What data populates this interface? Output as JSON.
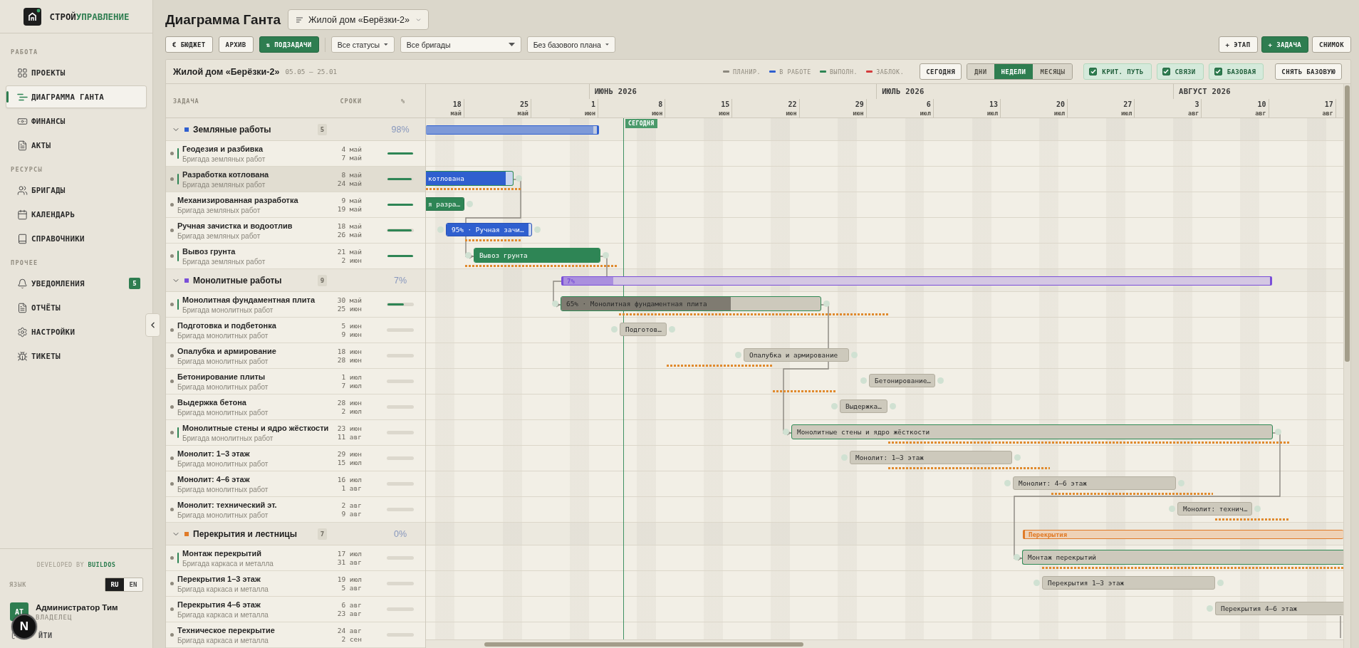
{
  "sidebar": {
    "brand": {
      "prefix": "СТРОЙ",
      "suffix": "УПРАВЛЕНИЕ"
    },
    "sections": [
      {
        "title": "РАБОТА",
        "items": [
          {
            "label": "ПРОЕКТЫ",
            "selected": false
          },
          {
            "label": "ДИАГРАММА ГАНТА",
            "selected": true
          },
          {
            "label": "ФИНАНСЫ",
            "selected": false
          },
          {
            "label": "АКТЫ",
            "selected": false
          }
        ]
      },
      {
        "title": "РЕСУРСЫ",
        "items": [
          {
            "label": "БРИГАДЫ",
            "selected": false
          },
          {
            "label": "КАЛЕНДАРЬ",
            "selected": false
          },
          {
            "label": "СПРАВОЧНИКИ",
            "selected": false
          }
        ]
      },
      {
        "title": "ПРОЧЕЕ",
        "items": [
          {
            "label": "УВЕДОМЛЕНИЯ",
            "selected": false,
            "badge": "5"
          },
          {
            "label": "ОТЧЁТЫ",
            "selected": false
          },
          {
            "label": "НАСТРОЙКИ",
            "selected": false
          },
          {
            "label": "ТИКЕТЫ",
            "selected": false
          }
        ]
      }
    ],
    "credit": "DEVELOPED BY **BUILDOS**",
    "language_label": "ЯЗЫК",
    "languages": [
      {
        "label": "RU",
        "selected": true
      },
      {
        "label": "EN",
        "selected": false
      }
    ],
    "user": {
      "initials": "АТ",
      "name": "Администратор Тим",
      "role": "ВЛАДЕЛЕЦ"
    },
    "logout": "ЙТИ"
  },
  "dev_badge": "N",
  "header": {
    "title": "Диаграмма Ганта",
    "project": "Жилой дом «Берёзки-2»"
  },
  "toolbar": {
    "toggles": [
      {
        "label": "€ БЮДЖЕТ",
        "on": false
      },
      {
        "label": "АРХИВ",
        "on": false
      },
      {
        "label": "⇅ ПОДЗАДАЧИ",
        "on": true
      }
    ],
    "filters": [
      "Все статусы",
      "Все бригады",
      "Без базового плана"
    ],
    "actions": [
      {
        "label": "+ ЭТАП",
        "primary": false
      },
      {
        "label": "+ ЗАДАЧА",
        "primary": true
      },
      {
        "label": "СНИМОК",
        "primary": false
      }
    ]
  },
  "gantt": {
    "title": "Жилой дом «Берёзки-2»",
    "range": "05.05 — 25.01",
    "legend": [
      {
        "label": "ПЛАНИР.",
        "color": "#8c887e"
      },
      {
        "label": "В РАБОТЕ",
        "color": "#2f5fcf"
      },
      {
        "label": "ВЫПОЛН.",
        "color": "#2e8555"
      },
      {
        "label": "ЗАБЛОК.",
        "color": "#d43c3c"
      }
    ],
    "today_button": "СЕГОДНЯ",
    "scales": [
      {
        "label": "ДНИ",
        "selected": false
      },
      {
        "label": "НЕДЕЛИ",
        "selected": true
      },
      {
        "label": "МЕСЯЦЫ",
        "selected": false
      }
    ],
    "toggles": [
      {
        "kind": "critical",
        "label": "КРИТ. ПУТЬ",
        "checked": true
      },
      {
        "kind": "links",
        "label": "СВЯЗИ",
        "checked": true
      },
      {
        "kind": "baseline",
        "label": "БАЗОВАЯ",
        "checked": true
      }
    ],
    "clear_baseline": "СНЯТЬ БАЗОВУЮ",
    "columns": {
      "task": "ЗАДАЧА",
      "dates": "СРОКИ",
      "percent": "%"
    },
    "months": [
      "ИЮНЬ 2026",
      "ИЮЛЬ 2026",
      "АВГУСТ 2026"
    ],
    "weeks": [
      {
        "day": "18",
        "month": "май"
      },
      {
        "day": "25",
        "month": "май"
      },
      {
        "day": "1",
        "month": "июн"
      },
      {
        "day": "8",
        "month": "июн"
      },
      {
        "day": "15",
        "month": "июн"
      },
      {
        "day": "22",
        "month": "июн"
      },
      {
        "day": "29",
        "month": "июн"
      },
      {
        "day": "6",
        "month": "июл"
      },
      {
        "day": "13",
        "month": "июл"
      },
      {
        "day": "20",
        "month": "июл"
      },
      {
        "day": "27",
        "month": "июл"
      },
      {
        "day": "3",
        "month": "авг"
      },
      {
        "day": "10",
        "month": "авг"
      },
      {
        "day": "17",
        "month": "авг"
      }
    ],
    "today_label": "СЕГОДНЯ",
    "groups": [
      {
        "name": "Земляные работы",
        "color": "#2f5fcf",
        "count": "5",
        "percent": "98%",
        "level": 0.98,
        "expanded": true,
        "tasks": [
          {
            "name": "Геодезия и разбивка",
            "crew": "Бригада земляных работ",
            "start": "4 май",
            "end": "7 май",
            "level": 1,
            "critical": true,
            "selected": false
          },
          {
            "name": "Разработка котлована",
            "crew": "Бригада земляных работ",
            "start": "8 май",
            "end": "24 май",
            "level": 0.95,
            "kind": "active",
            "critical": true,
            "selected": true,
            "bar_label": "котлована"
          },
          {
            "name": "Механизированная разработка",
            "crew": "Бригада земляных работ",
            "start": "9 май",
            "end": "19 май",
            "level": 1,
            "kind": "done",
            "critical": false,
            "selected": false,
            "bar_label": "я разра…"
          },
          {
            "name": "Ручная зачистка и водоотлив",
            "crew": "Бригада земляных работ",
            "start": "18 май",
            "end": "26 май",
            "level": 0.95,
            "kind": "active",
            "critical": false,
            "selected": false,
            "bar_label": "95% · Ручная зачи…"
          },
          {
            "name": "Вывоз грунта",
            "crew": "Бригада земляных работ",
            "start": "21 май",
            "end": "2 июн",
            "level": 1,
            "kind": "done",
            "critical": true,
            "selected": false,
            "bar_label": "Вывоз грунта"
          }
        ]
      },
      {
        "name": "Монолитные работы",
        "color": "#7a4fd8",
        "count": "9",
        "percent": "7%",
        "level": 0.07,
        "expanded": true,
        "bar_label": "7%",
        "tasks": [
          {
            "name": "Монолитная фундаментная плита",
            "crew": "Бригада монолитных работ",
            "start": "30 май",
            "end": "25 июн",
            "level": 0.65,
            "kind": "planned",
            "critical": true,
            "selected": false,
            "bar_label": "65% · Монолитная фундаментная плита"
          },
          {
            "name": "Подготовка и подбетонка",
            "crew": "Бригада монолитных работ",
            "start": "5 июн",
            "end": "9 июн",
            "level": 0,
            "kind": "planned",
            "critical": false,
            "selected": false,
            "bar_label": "Подготов…"
          },
          {
            "name": "Опалубка и армирование",
            "crew": "Бригада монолитных работ",
            "start": "18 июн",
            "end": "28 июн",
            "level": 0,
            "kind": "planned",
            "critical": false,
            "selected": false,
            "bar_label": "Опалубка и армирование"
          },
          {
            "name": "Бетонирование плиты",
            "crew": "Бригада монолитных работ",
            "start": "1 июл",
            "end": "7 июл",
            "level": 0,
            "kind": "planned",
            "critical": false,
            "selected": false,
            "bar_label": "Бетонирование…"
          },
          {
            "name": "Выдержка бетона",
            "crew": "Бригада монолитных работ",
            "start": "28 июн",
            "end": "2 июл",
            "level": 0,
            "kind": "planned",
            "critical": false,
            "selected": false,
            "bar_label": "Выдержка…"
          },
          {
            "name": "Монолитные стены и ядро жёсткости",
            "crew": "Бригада монолитных работ",
            "start": "23 июн",
            "end": "11 авг",
            "level": 0,
            "kind": "planned",
            "critical": true,
            "selected": false,
            "bar_label": "Монолитные стены и ядро жёсткости"
          },
          {
            "name": "Монолит: 1–3 этаж",
            "crew": "Бригада монолитных работ",
            "start": "29 июн",
            "end": "15 июл",
            "level": 0,
            "kind": "planned",
            "critical": false,
            "selected": false,
            "bar_label": "Монолит: 1–3 этаж"
          },
          {
            "name": "Монолит: 4–6 этаж",
            "crew": "Бригада монолитных работ",
            "start": "16 июл",
            "end": "1 авг",
            "level": 0,
            "kind": "planned",
            "critical": false,
            "selected": false,
            "bar_label": "Монолит: 4–6 этаж"
          },
          {
            "name": "Монолит: технический эт.",
            "crew": "Бригада монолитных работ",
            "start": "2 авг",
            "end": "9 авг",
            "level": 0,
            "kind": "planned",
            "critical": false,
            "selected": false,
            "bar_label": "Монолит: технич…"
          }
        ]
      },
      {
        "name": "Перекрытия и лестницы",
        "color": "#e07b28",
        "count": "7",
        "percent": "0%",
        "expanded": true,
        "bar_label": "Перекрытия",
        "tasks": [
          {
            "name": "Монтаж перекрытий",
            "crew": "Бригада каркаса и металла",
            "start": "17 июл",
            "end": "31 авг",
            "level": 0,
            "kind": "planned",
            "critical": true,
            "selected": false,
            "bar_label": "Монтаж перекрытий"
          },
          {
            "name": "Перекрытия 1–3 этаж",
            "crew": "Бригада каркаса и металла",
            "start": "19 июл",
            "end": "5 авг",
            "level": 0,
            "kind": "planned",
            "critical": false,
            "selected": false,
            "bar_label": "Перекрытия 1–3 этаж"
          },
          {
            "name": "Перекрытия 4–6 этаж",
            "crew": "Бригада каркаса и металла",
            "start": "6 авг",
            "end": "23 авг",
            "level": 0,
            "kind": "planned",
            "critical": false,
            "selected": false,
            "bar_label": "Перекрытия 4–6 этаж"
          },
          {
            "name": "Техническое перекрытие",
            "crew": "Бригада каркаса и металла",
            "start": "24 авг",
            "end": "2 сен",
            "level": 0,
            "critical": false,
            "selected": false
          }
        ]
      }
    ]
  }
}
